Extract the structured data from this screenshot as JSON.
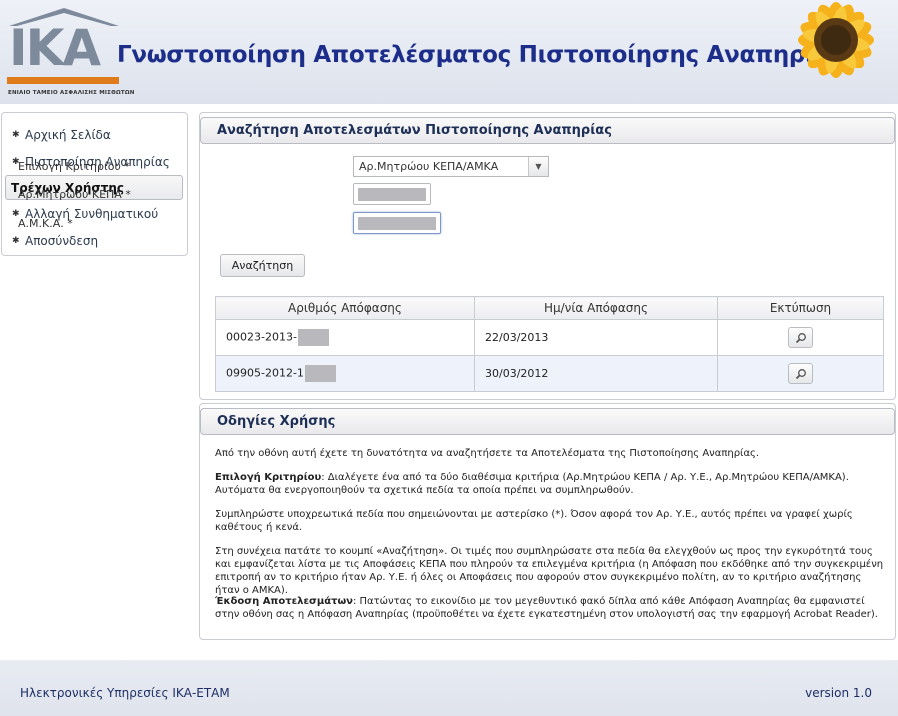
{
  "header": {
    "logo_text": "IKA",
    "logo_subtitle": "ΕΝΙΑΙΟ ΤΑΜΕΙΟ ΑΣΦΑΛΙΣΗΣ ΜΙΣΘΩΤΩΝ",
    "title": "Γνωστοποίηση Αποτελέσματος Πιστοποίησης Αναπηρίας"
  },
  "sidebar": {
    "items": [
      {
        "label": "Αρχική Σελίδα"
      },
      {
        "label": "Πιστοποίηση Αναπηρίας"
      },
      {
        "label": "Τρέχων Χρήστης"
      },
      {
        "label": "Αλλαγή Συνθηματικού"
      },
      {
        "label": "Αποσύνδεση"
      }
    ]
  },
  "search": {
    "title": "Αναζήτηση Αποτελεσμάτων Πιστοποίησης Αναπηρίας",
    "criterion_label": "Επιλογή Κριτηρίου *",
    "criterion_value": "Αρ.Μητρώου ΚΕΠΑ/ΑΜΚΑ",
    "kepa_label": "Αρ.Μητρώου ΚΕΠΑ *",
    "amka_label": "Α.Μ.Κ.Α. *",
    "button": "Αναζήτηση"
  },
  "results": {
    "headers": [
      "Αριθμός Απόφασης",
      "Ημ/νία Απόφασης",
      "Εκτύπωση"
    ],
    "rows": [
      {
        "number": "00023-2013-",
        "date": "22/03/2013"
      },
      {
        "number": "09905-2012-1",
        "date": "30/03/2012"
      }
    ]
  },
  "instructions": {
    "title": "Οδηγίες Χρήσης",
    "p1": "Από την οθόνη αυτή έχετε τη δυνατότητα να αναζητήσετε τα Αποτελέσματα της Πιστοποίησης Αναπηρίας.",
    "p2_bold": "Επιλογή Κριτηρίου",
    "p2": ": Διαλέγετε ένα από τα δύο διαθέσιμα κριτήρια (Αρ.Μητρώου ΚΕΠΑ / Αρ. Υ.Ε., Αρ.Μητρώου ΚΕΠΑ/ΑΜΚΑ). Αυτόματα θα ενεργοποιηθούν τα σχετικά πεδία τα οποία πρέπει να συμπληρωθούν.",
    "p3": "Συμπληρώστε υποχρεωτικά πεδία που σημειώνονται με αστερίσκο (*). Όσον αφορά τον Αρ. Υ.Ε., αυτός πρέπει να γραφεί χωρίς καθέτους ή κενά.",
    "p4": "Στη συνέχεια πατάτε το κουμπί «Αναζήτηση». Οι τιμές που συμπληρώσατε στα πεδία θα ελεγχθούν ως προς την εγκυρότητά τους και εμφανίζεται λίστα με τις Αποφάσεις ΚΕΠΑ που πληρούν τα επιλεγμένα κριτήρια (η Απόφαση που εκδόθηκε από την συγκεκριμένη επιτροπή αν το κριτήριο ήταν Αρ. Υ.Ε. ή όλες οι Αποφάσεις που αφορούν στον συγκεκριμένο πολίτη, αν το κριτήριο αναζήτησης ήταν ο ΑΜΚΑ).",
    "p5_bold": "Έκδοση Αποτελεσμάτων",
    "p5": ": Πατώντας το εικονίδιο με τον μεγεθυντικό φακό δίπλα από κάθε Απόφαση Αναπηρίας θα εμφανιστεί στην οθόνη σας η Απόφαση Αναπηρίας (προϋποθέτει να έχετε εγκατεστημένη στον υπολογιστή σας την εφαρμογή Acrobat Reader)."
  },
  "footer": {
    "left": "Ηλεκτρονικές Υπηρεσίες ΙΚΑ-ΕΤΑΜ",
    "right": "version 1.0"
  },
  "colors": {
    "title_blue": "#1c2d8a",
    "logo_orange": "#e07b1c",
    "logo_gray": "#7d8a9c"
  }
}
